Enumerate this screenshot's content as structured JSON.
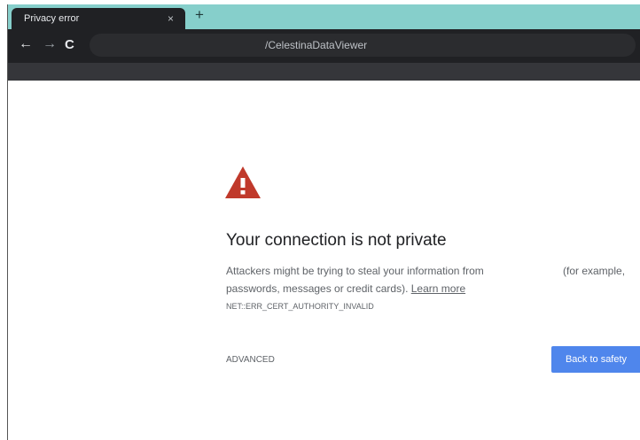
{
  "tab": {
    "title": "Privacy error",
    "close": "×",
    "new_tab": "+"
  },
  "toolbar": {
    "back": "←",
    "forward": "→",
    "reload": "C",
    "url": "/CelestinaDataViewer"
  },
  "page": {
    "heading": "Your connection is not private",
    "body_line1": "Attackers might be trying to steal your information from",
    "body_line1_end": "(for example,",
    "body_line2": "passwords, messages or credit cards).",
    "learn_more": "Learn more",
    "error_code": "NET::ERR_CERT_AUTHORITY_INVALID",
    "advanced": "ADVANCED",
    "back_to_safety": "Back to safety"
  },
  "colors": {
    "tabstrip": "#86cfcb",
    "toolbar": "#202124",
    "warning": "#c0392b",
    "primary_button": "#4f86ec"
  },
  "icons": {
    "warning": "warning-triangle-icon"
  }
}
